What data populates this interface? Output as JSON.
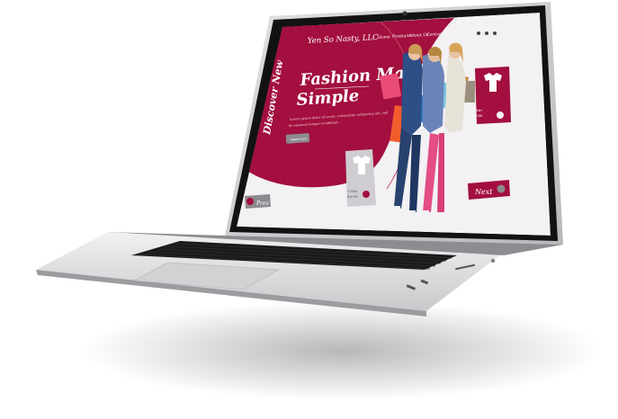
{
  "site": {
    "brand": "Yen So Nasty, LLC",
    "nav": [
      "Home",
      "Products",
      "About Us",
      "Contact Us"
    ],
    "vertical_label": "Discover New",
    "hero_title_line1": "Fashion Made",
    "hero_title_line2": "Simple",
    "hero_body_line1": "Lorem ipsum dolor sit amet, consectetur adipiscing elit, sed",
    "hero_body_line2": "do eiusmod tempor incididunt...",
    "read_more": "Read more",
    "product_card_right_line1": "T-Shirt",
    "product_card_right_line2": "$10.99",
    "product_card_bottom_line1": "T-Shirt",
    "product_card_bottom_line2": "$10.99",
    "prev_label": "Prev",
    "next_label": "Next"
  },
  "colors": {
    "brand": "#a30f3e",
    "screen_bg": "#f3f1f3",
    "laptop_silver": "#d9d9db",
    "bezel": "#121214"
  }
}
